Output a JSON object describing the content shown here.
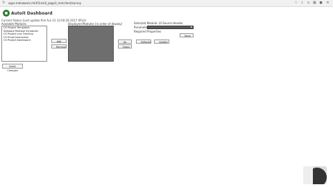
{
  "browser": {
    "url": "apps.mdxaware.ml/#2n/sdi_pago3_mmclient/survey"
  },
  "app": {
    "title": "Autoit Dashboard",
    "status_line": "Current Status (Last update fine fun 12 12:00:29 2017 XPLU)"
  },
  "available": {
    "heading": "Available Modules",
    "items": [
      "CS Project Templates",
      "Software Release Scheduler",
      "CS Project Live Tracking",
      "CS Email Interaction",
      "CS Project Dashboard"
    ]
  },
  "selected": {
    "heading": "Displayed Modules (in order of display)",
    "items": [
      "",
      "",
      "",
      "",
      ""
    ]
  },
  "buttons": {
    "add": "Add",
    "remove": "Remove",
    "up": "Up",
    "down": "Down",
    "restore": "Defaults",
    "update": "Update",
    "save": "Save",
    "apply": "Apply Changes"
  },
  "right_panel": {
    "heading": "Selected Module: UI Source Header",
    "field_label": "Parameter",
    "required_label": "Required Properties"
  }
}
